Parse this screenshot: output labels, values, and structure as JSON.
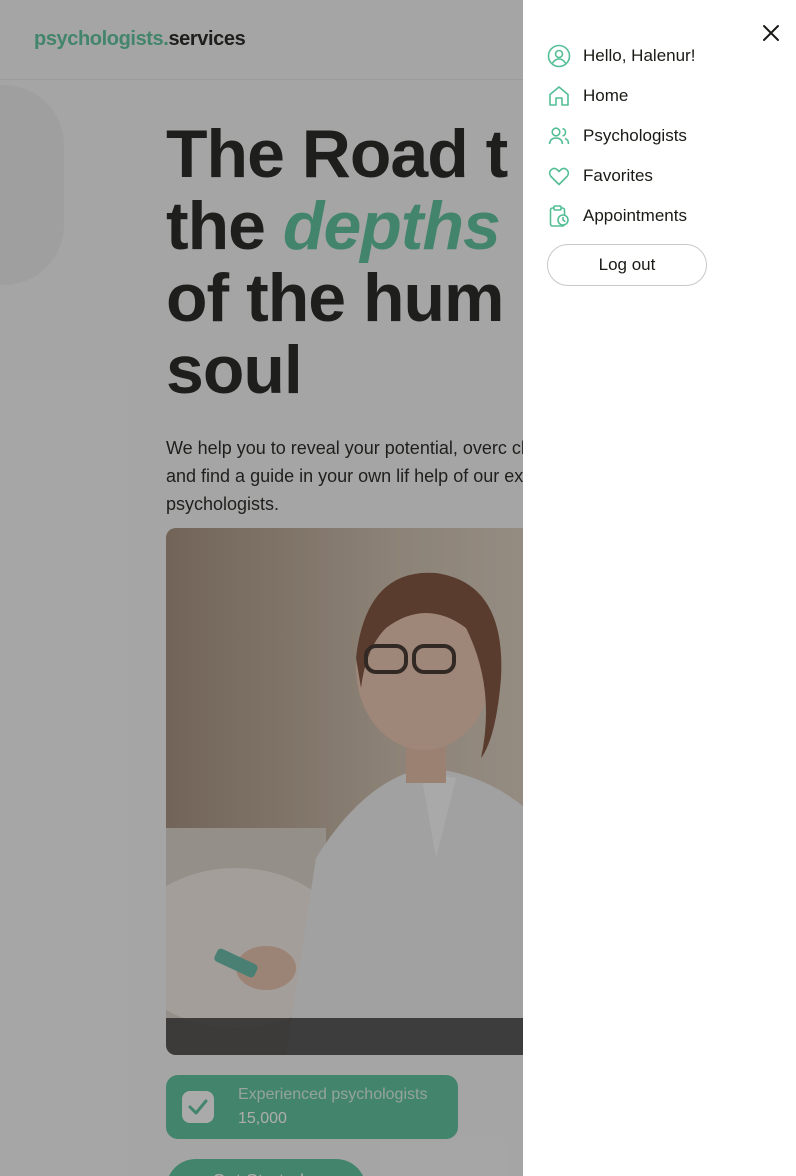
{
  "header": {
    "logo_primary": "psychologists",
    "logo_dot": ".",
    "logo_secondary": "services"
  },
  "hero": {
    "title_line1": "The Road t",
    "title_line2_plain": "the ",
    "title_line2_accent": "depths",
    "title_line3": "of the hum",
    "title_line4": "soul",
    "description": "We help you to reveal your potential, overc challenges and find a guide in your own lif help of our experienced psychologists.",
    "stat_label": "Experienced psychologists",
    "stat_value": "15,000",
    "cta_label": "Get Started ↗"
  },
  "menu": {
    "greeting": "Hello, Halenur!",
    "items": [
      {
        "label": "Home",
        "icon": "home-icon"
      },
      {
        "label": "Psychologists",
        "icon": "users-icon"
      },
      {
        "label": "Favorites",
        "icon": "heart-icon"
      },
      {
        "label": "Appointments",
        "icon": "clipboard-clock-icon"
      }
    ],
    "logout_label": "Log out"
  },
  "colors": {
    "accent": "#54be96",
    "text": "#191a15",
    "menu_bg": "#ffffff"
  }
}
